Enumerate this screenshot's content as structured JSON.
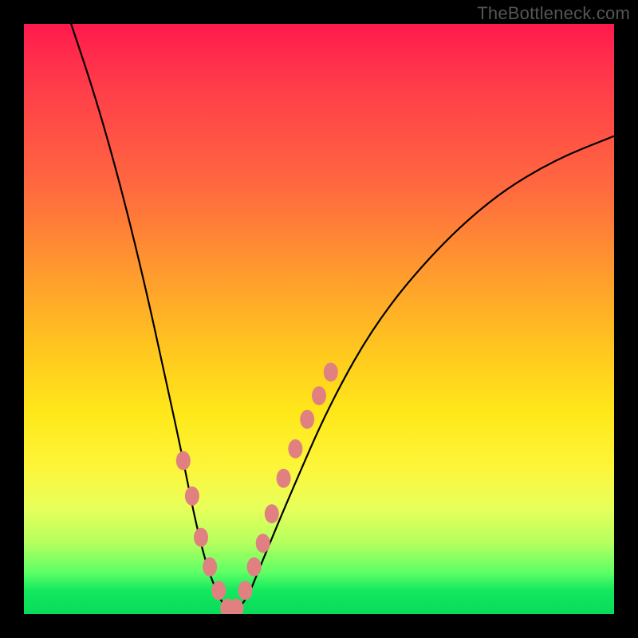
{
  "attribution": "TheBottleneck.com",
  "chart_data": {
    "type": "line",
    "title": "",
    "xlabel": "",
    "ylabel": "",
    "xlim": [
      0,
      100
    ],
    "ylim": [
      0,
      100
    ],
    "series": [
      {
        "name": "bottleneck-curve",
        "x": [
          8,
          12,
          16,
          20,
          24,
          27,
          29,
          31,
          33,
          34.5,
          36,
          38,
          40,
          45,
          52,
          60,
          70,
          80,
          90,
          100
        ],
        "values": [
          100,
          88,
          74,
          58,
          40,
          26,
          16,
          8,
          3,
          0.5,
          0.5,
          3,
          8,
          20,
          36,
          50,
          62,
          71,
          77,
          81
        ]
      }
    ],
    "markers": {
      "name": "highlighted-points",
      "color": "#e08080",
      "x": [
        27,
        28.5,
        30,
        31.5,
        33,
        34.5,
        36,
        37.5,
        39,
        40.5,
        42,
        44,
        46,
        48,
        50,
        52
      ],
      "values": [
        26,
        20,
        13,
        8,
        4,
        1,
        1,
        4,
        8,
        12,
        17,
        23,
        28,
        33,
        37,
        41
      ]
    }
  }
}
